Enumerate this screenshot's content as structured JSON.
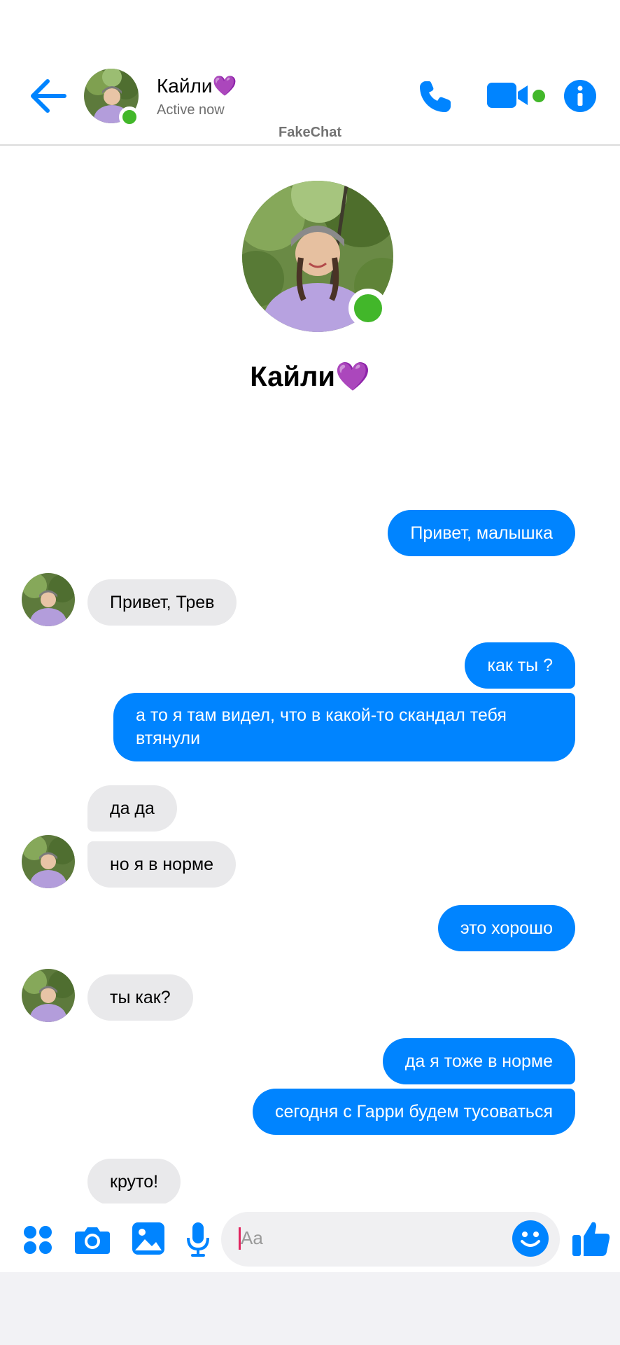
{
  "header": {
    "contact_name": "Кайли💜",
    "status": "Active now",
    "brand": "FakeChat"
  },
  "profile": {
    "name": "Кайли💜"
  },
  "messages": [
    {
      "dir": "out",
      "text": "Привет, малышка"
    },
    {
      "dir": "in",
      "text": "Привет, Трев"
    },
    {
      "dir": "out",
      "text": "как ты ?"
    },
    {
      "dir": "out",
      "text": "а то я там видел, что в какой-то скандал тебя втянули"
    },
    {
      "dir": "in",
      "text": "да да"
    },
    {
      "dir": "in",
      "text": "но я в норме"
    },
    {
      "dir": "out",
      "text": "это хорошо"
    },
    {
      "dir": "in",
      "text": "ты как?"
    },
    {
      "dir": "out",
      "text": "да я тоже в норме"
    },
    {
      "dir": "out",
      "text": "сегодня с Гарри будем тусоваться"
    },
    {
      "dir": "in",
      "text": "круто!"
    }
  ],
  "composer": {
    "placeholder": "Aa"
  },
  "icons": {
    "back": "arrow-left-icon",
    "call": "phone-icon",
    "video": "video-camera-icon",
    "info": "info-icon",
    "apps": "four-dots-icon",
    "camera": "camera-icon",
    "gallery": "image-icon",
    "mic": "microphone-icon",
    "emoji": "smiley-icon",
    "like": "thumbs-up-icon"
  },
  "colors": {
    "accent": "#0084ff",
    "online": "#42b72a",
    "incoming_bubble": "#e9e9eb"
  }
}
